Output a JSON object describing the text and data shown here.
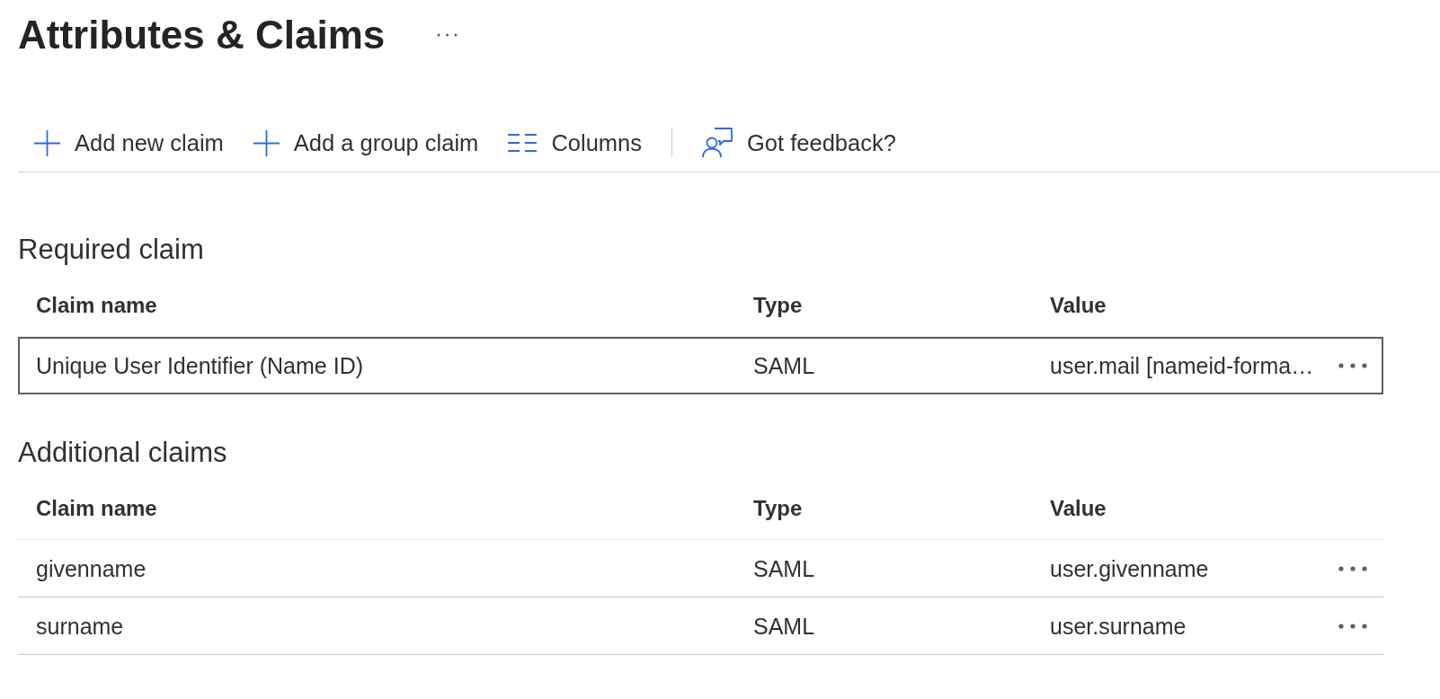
{
  "page": {
    "title": "Attributes & Claims"
  },
  "toolbar": {
    "items": [
      {
        "kind": "add",
        "label": "Add new claim"
      },
      {
        "kind": "add",
        "label": "Add a group claim"
      },
      {
        "kind": "columns",
        "label": "Columns"
      },
      {
        "kind": "divider"
      },
      {
        "kind": "feedback",
        "label": "Got feedback?"
      }
    ]
  },
  "sections": [
    {
      "title": "Required claim",
      "columns": [
        "Claim name",
        "Type",
        "Value"
      ],
      "rows": [
        {
          "claim_name": "Unique User Identifier (Name ID)",
          "type": "SAML",
          "value": "user.mail [nameid-forma…",
          "selected": true
        }
      ]
    },
    {
      "title": "Additional claims",
      "columns": [
        "Claim name",
        "Type",
        "Value"
      ],
      "rows": [
        {
          "claim_name": "givenname",
          "type": "SAML",
          "value": "user.givenname",
          "selected": false
        },
        {
          "claim_name": "surname",
          "type": "SAML",
          "value": "user.surname",
          "selected": false
        }
      ]
    }
  ]
}
